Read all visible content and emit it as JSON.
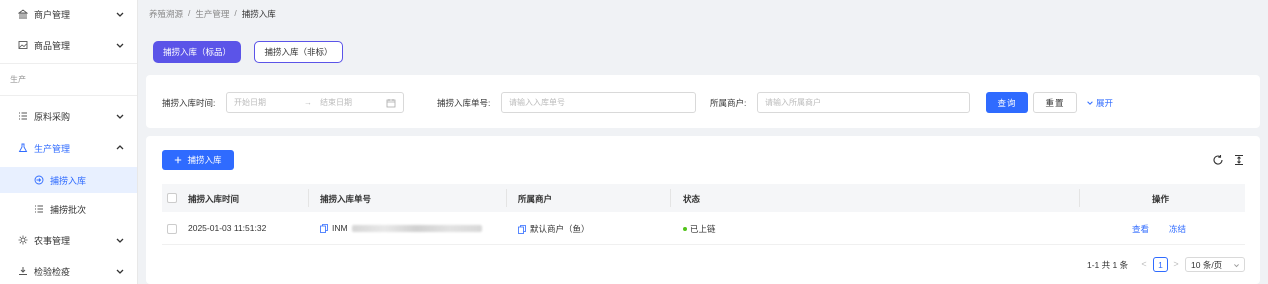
{
  "sidebar": {
    "items": [
      {
        "label": "商户管理"
      },
      {
        "label": "商品管理"
      },
      {
        "label": "原料采购"
      },
      {
        "label": "生产管理"
      },
      {
        "label": "捕捞入库"
      },
      {
        "label": "捕捞批次"
      },
      {
        "label": "农事管理"
      },
      {
        "label": "检验检疫"
      }
    ],
    "group_label": "生产"
  },
  "breadcrumb": {
    "root": "养殖溯源",
    "sep": "/",
    "parent": "生产管理",
    "current": "捕捞入库"
  },
  "tabs": {
    "standard": "捕捞入库（标品）",
    "nonstandard": "捕捞入库（非标）"
  },
  "filters": {
    "time_label": "捕捞入库时间:",
    "start_placeholder": "开始日期",
    "arrow": "→",
    "end_placeholder": "结束日期",
    "order_label": "捕捞入库单号:",
    "order_placeholder": "请输入入库单号",
    "merchant_label": "所属商户:",
    "merchant_placeholder": "请输入所属商户",
    "query": "查询",
    "reset": "重置",
    "expand": "展开"
  },
  "toolbar": {
    "add_label": "捕捞入库"
  },
  "table": {
    "columns": [
      "捕捞入库时间",
      "捕捞入库单号",
      "所属商户",
      "状态",
      "操作"
    ],
    "rows": [
      {
        "time": "2025-01-03 11:51:32",
        "order_prefix": "INM",
        "merchant": "默认商户（鱼）",
        "status": "已上链",
        "actions": [
          "查看",
          "冻结"
        ]
      }
    ]
  },
  "pagination": {
    "total": "1-1 共 1 条",
    "prev": "<",
    "page": "1",
    "next": ">",
    "page_size": "10 条/页"
  },
  "colors": {
    "primary": "#2f6bff",
    "tab_purple": "#5b54e8",
    "status_green": "#52c41a"
  }
}
